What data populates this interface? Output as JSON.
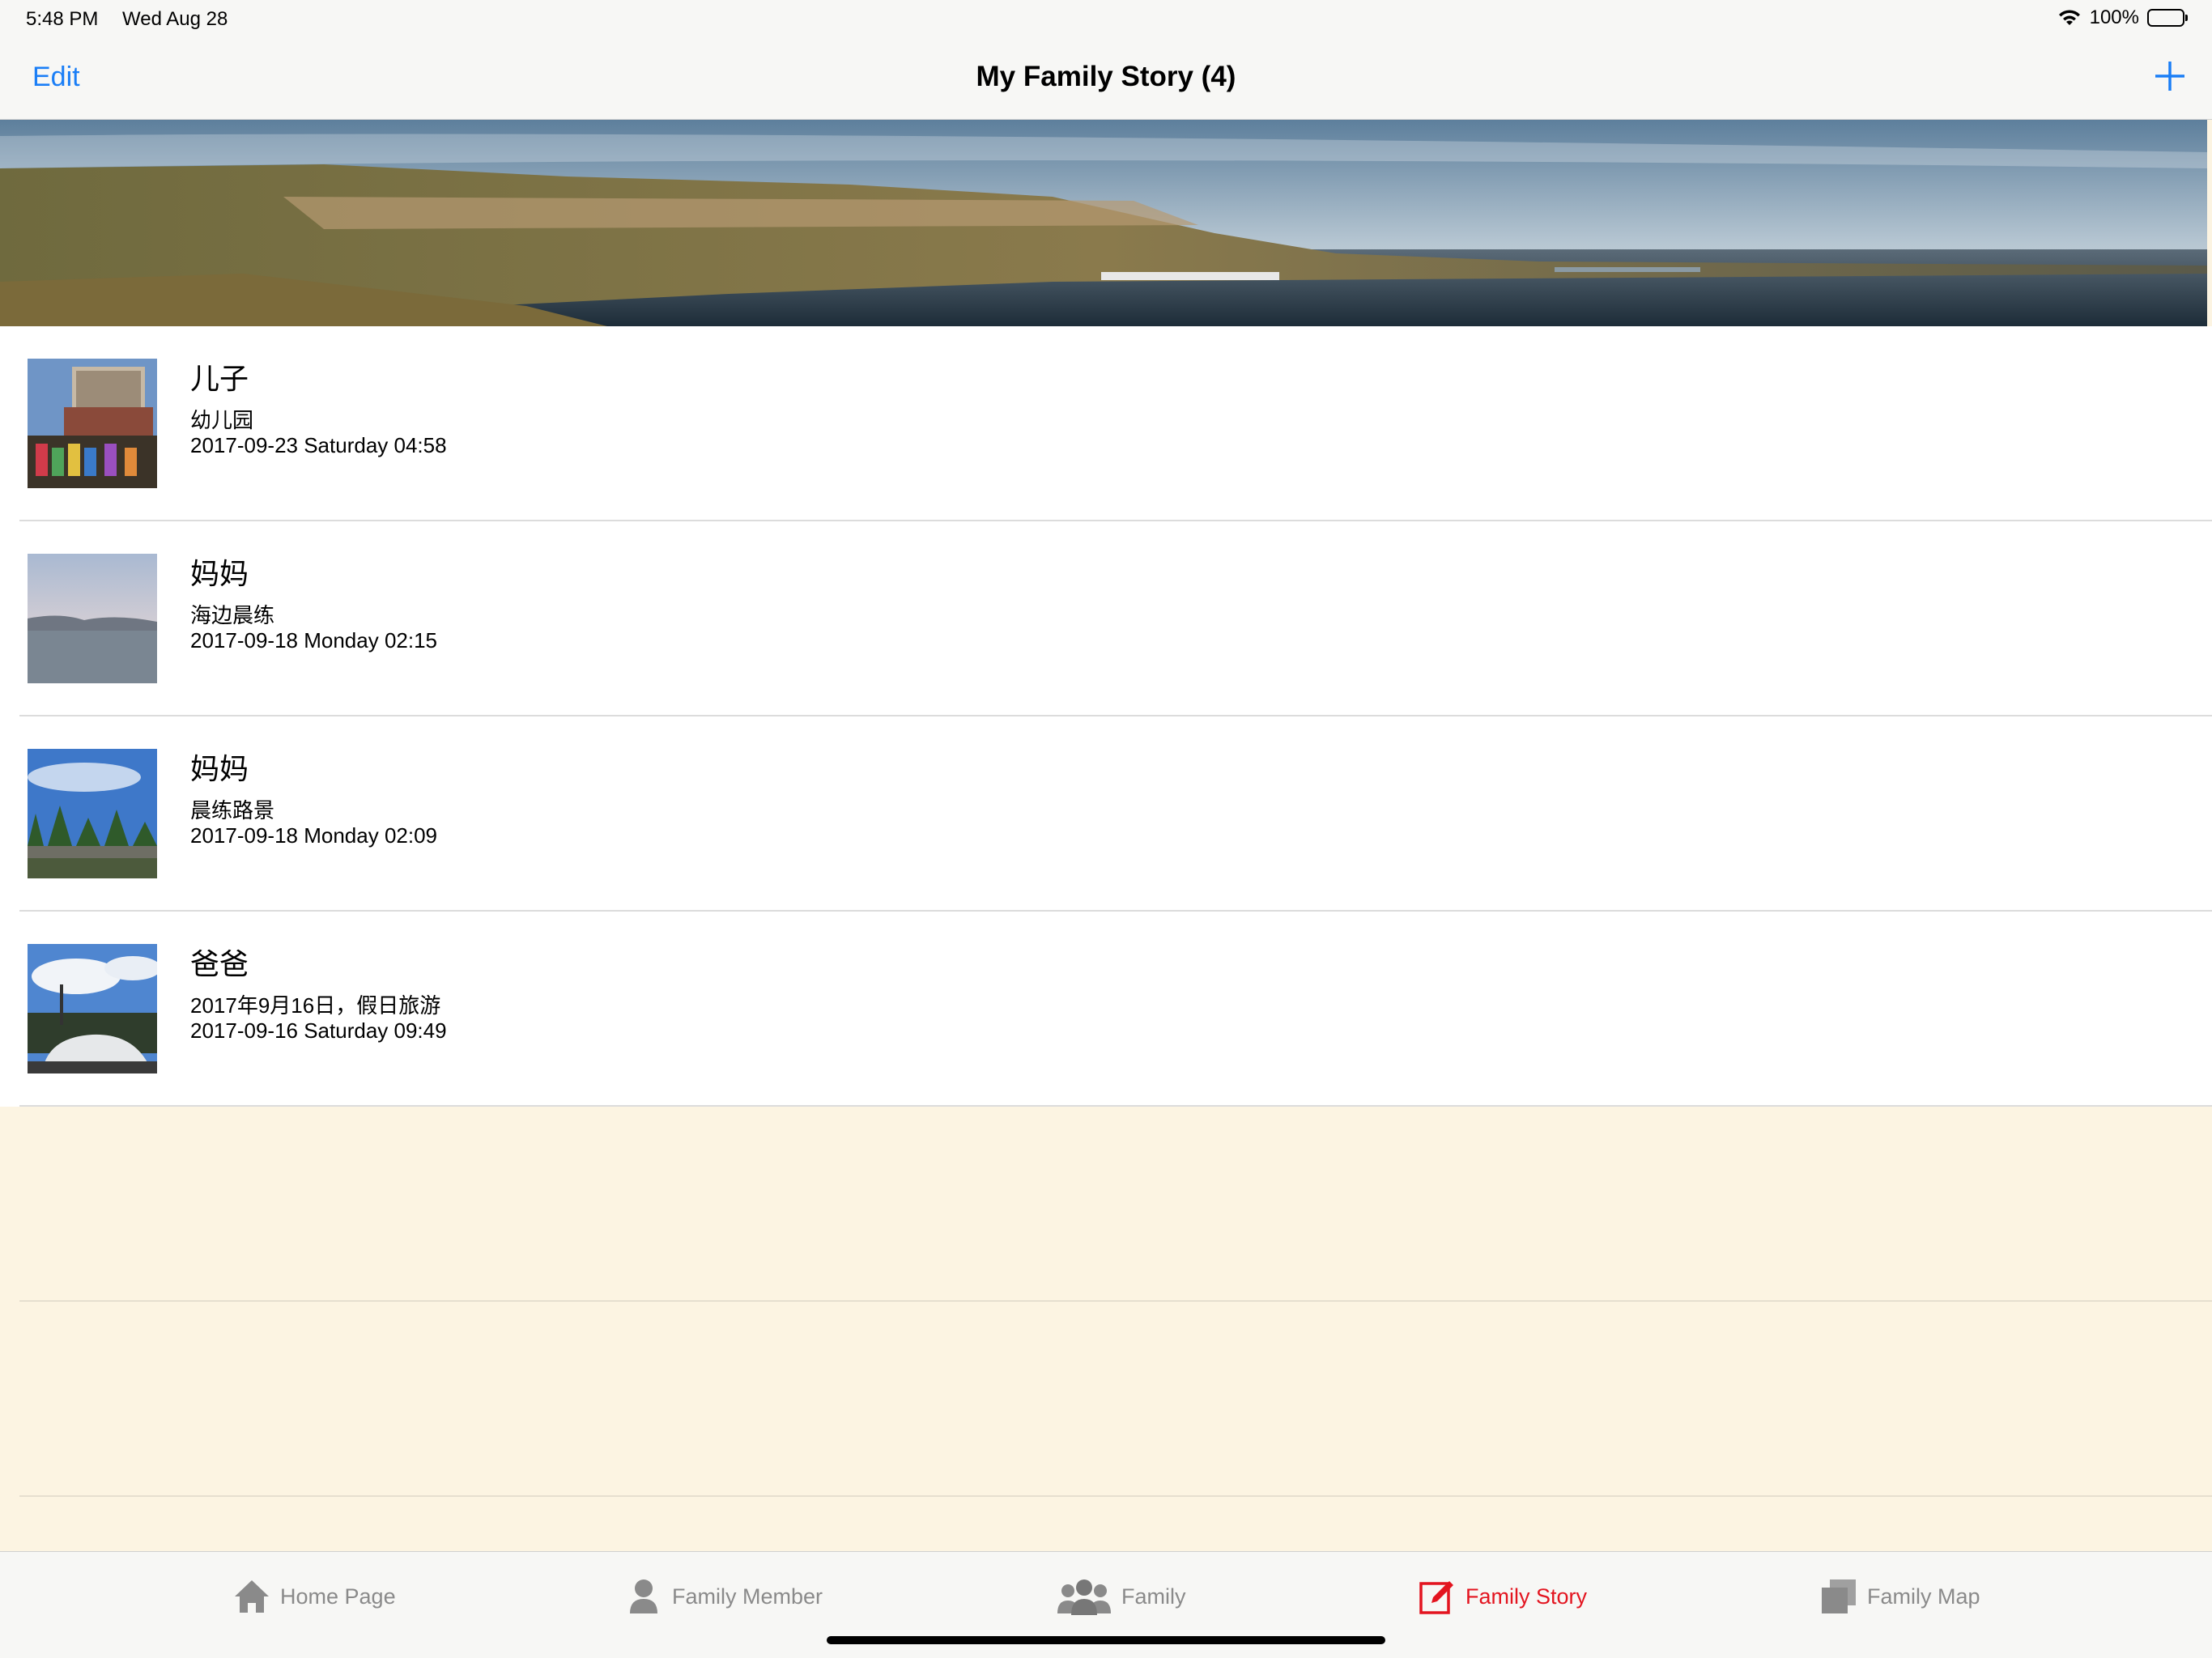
{
  "status_bar": {
    "time": "5:48 PM",
    "date": "Wed Aug 28",
    "battery": "100%",
    "icons": [
      "wifi-icon",
      "battery-icon"
    ]
  },
  "nav": {
    "edit_label": "Edit",
    "title": "My Family Story (4)",
    "add_icon": "plus-icon",
    "accent_color": "#1a7ef6"
  },
  "banner": {
    "image": "seaside-coast-panorama"
  },
  "stories": [
    {
      "title": "儿子",
      "desc": "幼儿园",
      "date": "2017-09-23 Saturday 04:58",
      "thumb": "kindergarten-building"
    },
    {
      "title": "妈妈",
      "desc": "海边晨练",
      "date": "2017-09-18 Monday 02:15",
      "thumb": "sea-at-dawn"
    },
    {
      "title": "妈妈",
      "desc": "晨练路景",
      "date": "2017-09-18 Monday 02:09",
      "thumb": "trees-blue-sky"
    },
    {
      "title": "爸爸",
      "desc": "2017年9月16日，假日旅游",
      "date": "2017-09-16 Saturday 09:49",
      "thumb": "car-and-trees"
    }
  ],
  "tabs": [
    {
      "label": "Home Page",
      "icon": "house-icon",
      "active": false
    },
    {
      "label": "Family Member",
      "icon": "person-icon",
      "active": false
    },
    {
      "label": "Family",
      "icon": "group-icon",
      "active": false
    },
    {
      "label": "Family Story",
      "icon": "edit-icon",
      "active": true
    },
    {
      "label": "Family Map",
      "icon": "pages-icon",
      "active": false
    }
  ],
  "colors": {
    "active_tab": "#e3141f",
    "inactive_tab": "#8a8a8a",
    "empty_background": "#fcf4e2"
  }
}
